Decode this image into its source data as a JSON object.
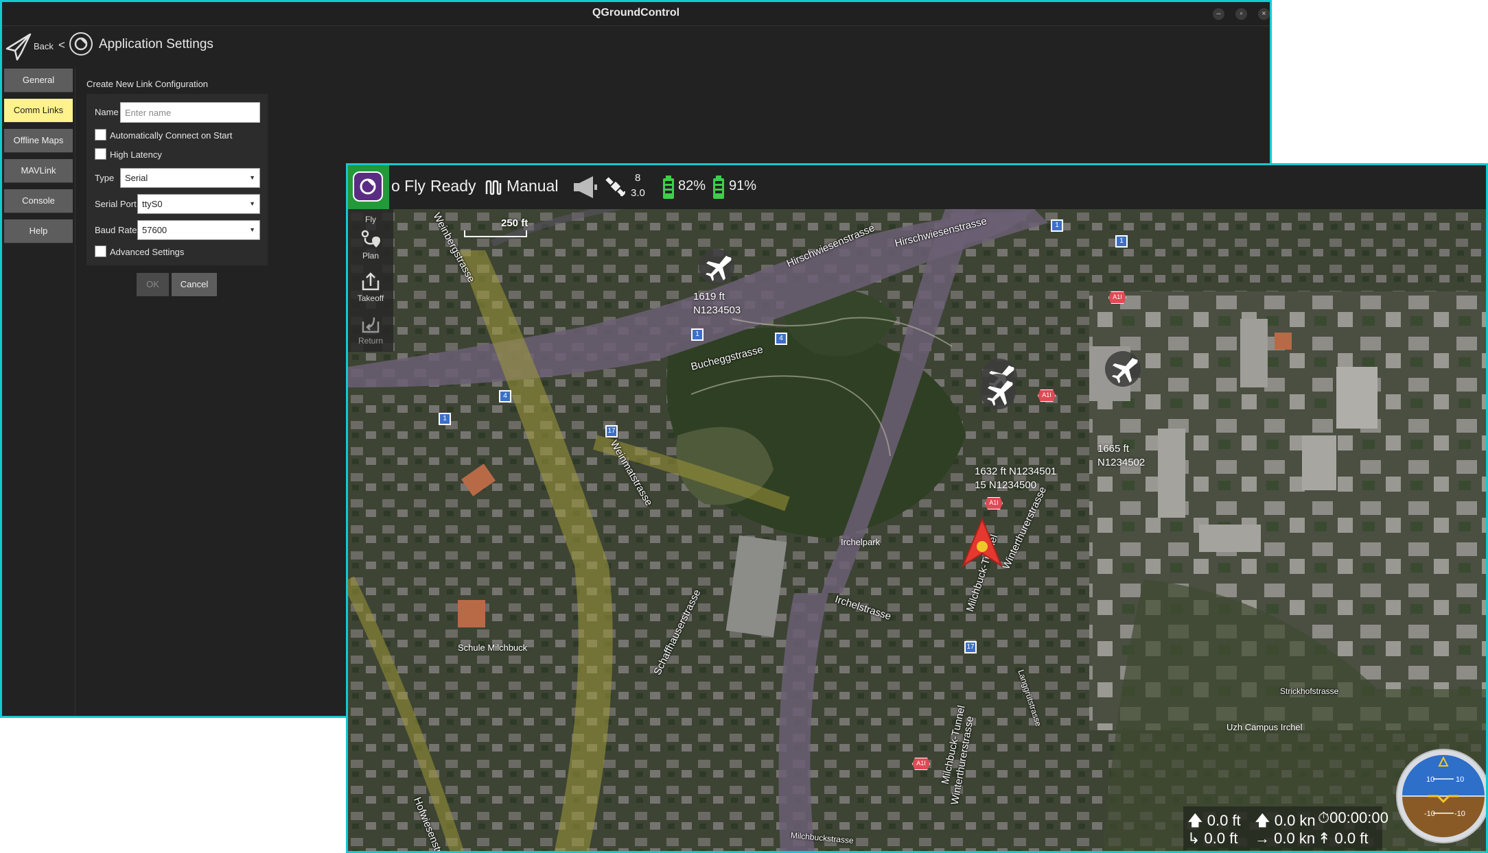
{
  "settings_window": {
    "title": "QGroundControl",
    "controls": {
      "minimize": "–",
      "restore": "▫",
      "close": "×"
    },
    "header": {
      "back_label": "Back",
      "separator": "<",
      "page_title": "Application Settings"
    },
    "menu": [
      {
        "label": "General",
        "active": false
      },
      {
        "label": "Comm Links",
        "active": true
      },
      {
        "label": "Offline Maps",
        "active": false
      },
      {
        "label": "MAVLink",
        "active": false
      },
      {
        "label": "Console",
        "active": false
      },
      {
        "label": "Help",
        "active": false
      }
    ],
    "form": {
      "heading": "Create New Link Configuration",
      "name_label": "Name",
      "name_placeholder": "Enter name",
      "auto_connect_label": "Automatically Connect on Start",
      "high_latency_label": "High Latency",
      "type_label": "Type",
      "type_value": "Serial",
      "serial_port_label": "Serial Port",
      "serial_port_value": "ttyS0",
      "baud_rate_label": "Baud Rate",
      "baud_rate_value": "57600",
      "advanced_label": "Advanced Settings",
      "ok_label": "OK",
      "cancel_label": "Cancel"
    }
  },
  "fly_window": {
    "toolbar": {
      "view_name": "o Fly",
      "status": "Ready",
      "flight_mode": "Manual",
      "satellite_count": "8",
      "hdop": "3.0",
      "battery1": "82%",
      "battery2": "91%",
      "battery_color": "#3cd04a"
    },
    "tools": [
      {
        "label": "Fly"
      },
      {
        "label": "Plan"
      },
      {
        "label": "Takeoff"
      },
      {
        "label": "Return"
      }
    ],
    "scale": "250 ft",
    "aircraft": [
      {
        "alt": "1619 ft",
        "id": "N1234503"
      },
      {
        "alt": "1665 ft",
        "id": "N1234502"
      },
      {
        "alt": "1632 ft",
        "id": "N1234501"
      },
      {
        "alt": "15",
        "id": "N1234500"
      }
    ],
    "map_labels": {
      "streets": [
        "Weinbergstrasse",
        "Hirschwiesenstrasse",
        "Hirschwiesenstrasse",
        "Bucheggstrasse",
        "Weinmatstrasse",
        "Irchelstrasse",
        "Schaffhauserstrasse",
        "Milchbuck-Tunnel",
        "Winterthurerstrasse",
        "Hofwiesenstrasse",
        "Milchbuck-Tunnel",
        "Winterthurerstrasse",
        "Langgrütstrasse",
        "Strickhofstrasse",
        "Milchbuckstrasse"
      ],
      "places": [
        "Irchelpark",
        "Schule Milchbuck",
        "Uzh Campus Irchel"
      ],
      "shields": [
        "1",
        "1",
        "1",
        "4",
        "4",
        "1",
        "17",
        "17"
      ],
      "shields_red": [
        "A1I",
        "A1I",
        "A1I",
        "A1I"
      ]
    },
    "telemetry": {
      "alt_rel": "0.0 ft",
      "vspeed": "0.0 kn",
      "flight_time": "00:00:00",
      "alt_amsl": "0.0 ft",
      "hspeed": "0.0 kn",
      "dist": "0.0 ft"
    },
    "attitude": {
      "pitch_up": "10",
      "pitch_up_r": "10",
      "pitch_down": "-10",
      "pitch_down_r": "-10"
    }
  }
}
